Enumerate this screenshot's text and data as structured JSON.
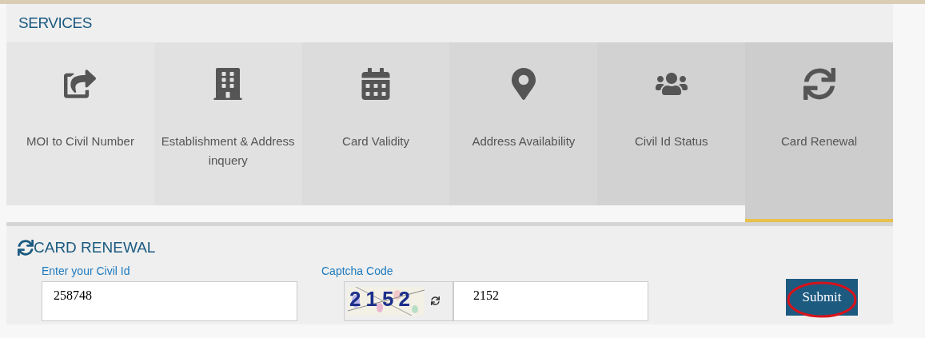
{
  "services": {
    "title": "SERVICES",
    "tiles": [
      {
        "label": "MOI to Civil Number",
        "selected": false
      },
      {
        "label": "Establishment & Address inquery",
        "selected": false
      },
      {
        "label": "Card Validity",
        "selected": false
      },
      {
        "label": "Address Availability",
        "selected": false
      },
      {
        "label": "Civil Id Status",
        "selected": false
      },
      {
        "label": "Card Renewal",
        "selected": true
      }
    ]
  },
  "form": {
    "title": "CARD RENEWAL",
    "civil_id": {
      "label": "Enter your Civil Id",
      "value": "258748"
    },
    "captcha": {
      "label": "Captcha Code",
      "image_text": "2152",
      "value": "2152"
    },
    "submit": "Submit"
  }
}
